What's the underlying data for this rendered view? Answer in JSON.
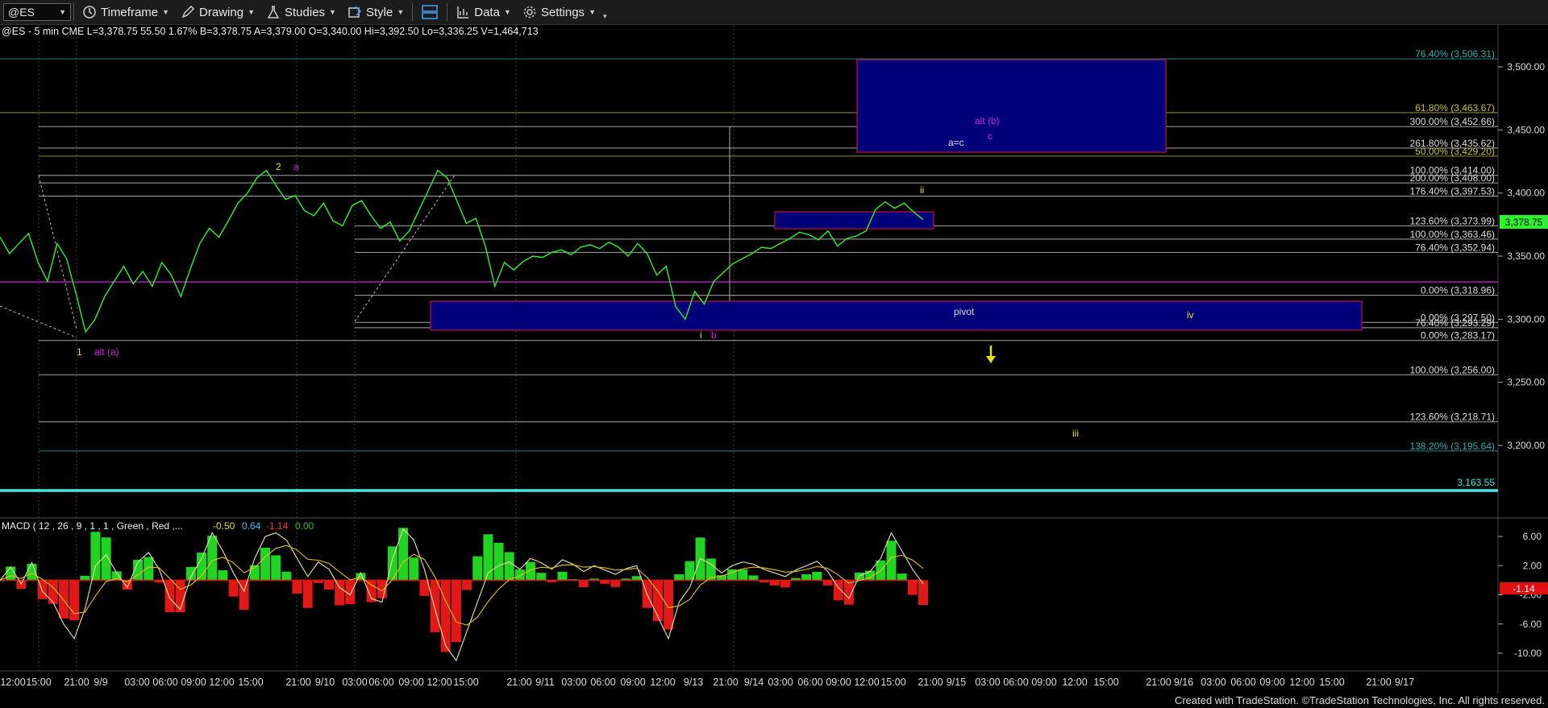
{
  "toolbar": {
    "symbol": "@ES",
    "items": [
      {
        "icon": "clock-icon",
        "label": "Timeframe"
      },
      {
        "icon": "pencil-icon",
        "label": "Drawing"
      },
      {
        "icon": "flask-icon",
        "label": "Studies"
      },
      {
        "icon": "style-icon",
        "label": "Style"
      },
      {
        "icon": "layout-icon",
        "label": ""
      },
      {
        "icon": "bar-chart-icon",
        "label": "Data"
      },
      {
        "icon": "gear-icon",
        "label": "Settings"
      }
    ]
  },
  "header_text": "@ES - 5 min  CME  L=3,378.75  55.50  1.67%  B=3,378.75  A=3,379.00  O=3,340.00  Hi=3,392.50  Lo=3,336.25  V=1,464,713",
  "macd_header": {
    "label": "MACD ( 12 , 26 , 9 , 1 , 1 , Green , Red ,...",
    "v1": "-0.50",
    "v2": "0.64",
    "v3": "-1.14",
    "v4": "0.00"
  },
  "footer": "Created with TradeStation. ©TradeStation Technologies, Inc. All rights reserved.",
  "colors": {
    "price": "#2ef22e",
    "magenta": "#d020e0",
    "yellow": "#e6e020",
    "cyan": "#40e0e0",
    "box": "#00007a",
    "boxBorder": "#c01040"
  },
  "chart_data": [
    {
      "type": "line",
      "title": "@ES - 5 min",
      "ylim": [
        3140,
        3520
      ],
      "y_ticks": [
        "3,500.00",
        "3,450.00",
        "3,400.00",
        "3,350.00",
        "3,300.00",
        "3,250.00",
        "3,200.00"
      ],
      "last_price": "3,378.75",
      "x_ticks": [
        "12:00",
        "15:00",
        "21:00",
        "9/9",
        "03:00",
        "06:00",
        "09:00",
        "12:00",
        "15:00",
        "21:00",
        "9/10",
        "03:00",
        "06:00",
        "09:00",
        "12:00",
        "15:00",
        "21:00",
        "9/11",
        "03:00",
        "06:00",
        "09:00",
        "12:00",
        "9/13",
        "21:00",
        "9/14",
        "03:00",
        "06:00",
        "09:00",
        "12:00",
        "15:00",
        "21:00",
        "9/15",
        "03:00",
        "06:00",
        "09:00",
        "12:00",
        "15:00",
        "21:00",
        "9/16",
        "03:00",
        "06:00",
        "09:00",
        "12:00",
        "15:00",
        "21:00",
        "9/17"
      ],
      "series": [
        {
          "values": [
            3365,
            3352,
            3360,
            3368,
            3345,
            3330,
            3360,
            3348,
            3320,
            3290,
            3300,
            3318,
            3330,
            3342,
            3328,
            3338,
            3326,
            3345,
            3335,
            3318,
            3340,
            3360,
            3372,
            3365,
            3378,
            3392,
            3400,
            3412,
            3418,
            3406,
            3395,
            3398,
            3386,
            3382,
            3392,
            3378,
            3374,
            3390,
            3394,
            3382,
            3372,
            3377,
            3362,
            3370,
            3386,
            3402,
            3418,
            3412,
            3394,
            3376,
            3380,
            3358,
            3326,
            3345,
            3339,
            3346,
            3350,
            3349,
            3353,
            3355,
            3351,
            3357,
            3359,
            3356,
            3361,
            3357,
            3350,
            3360,
            3352,
            3335,
            3342,
            3310,
            3300,
            3322,
            3312,
            3330,
            3337,
            3344,
            3348,
            3352,
            3357,
            3356,
            3360,
            3364,
            3369,
            3367,
            3363,
            3370,
            3358,
            3364,
            3366,
            3370,
            3387,
            3393,
            3388,
            3392,
            3385,
            3379
          ]
        }
      ],
      "fib_levels": [
        {
          "label": "76.40% (3,506.31)",
          "value": 3506.31,
          "color": "#2ab0b0"
        },
        {
          "label": "61.80% (3,463.67)",
          "value": 3463.67,
          "color": "#c8c030"
        },
        {
          "label": "300.00% (3,452.66)",
          "value": 3452.66,
          "color": "#dddddd"
        },
        {
          "label": "261.80% (3,435.62)",
          "value": 3435.62,
          "color": "#dddddd"
        },
        {
          "label": "50.00% (3,429.20)",
          "value": 3429.2,
          "color": "#c8c030"
        },
        {
          "label": "100.00% (3,414.00)",
          "value": 3414.0,
          "color": "#dddddd"
        },
        {
          "label": "200.00% (3,408.00)",
          "value": 3408.0,
          "color": "#dddddd"
        },
        {
          "label": "176.40% (3,397.53)",
          "value": 3397.53,
          "color": "#dddddd"
        },
        {
          "label": "123.60% (3,373.99)",
          "value": 3373.99,
          "color": "#dddddd"
        },
        {
          "label": "100.00% (3,363.46)",
          "value": 3363.46,
          "color": "#dddddd"
        },
        {
          "label": "76.40% (3,352.94)",
          "value": 3352.94,
          "color": "#dddddd"
        },
        {
          "label": "0.00% (3,318.96)",
          "value": 3318.96,
          "color": "#dddddd"
        },
        {
          "label": "0.00% (3,297.50)",
          "value": 3297.5,
          "color": "#dddddd"
        },
        {
          "label": "76.40% (3,293.29)",
          "value": 3293.29,
          "color": "#dddddd"
        },
        {
          "label": "0.00% (3,283.17)",
          "value": 3283.17,
          "color": "#dddddd"
        },
        {
          "label": "100.00% (3,256.00)",
          "value": 3256.0,
          "color": "#dddddd"
        },
        {
          "label": "123.60% (3,218.71)",
          "value": 3218.71,
          "color": "#dddddd"
        },
        {
          "label": "138.20% (3,195.64)",
          "value": 3195.64,
          "color": "#2ab0b0"
        }
      ],
      "support_line": {
        "label": "3,163.55",
        "value": 3163.55
      },
      "annotations": [
        {
          "text": "1",
          "color": "#e6e020"
        },
        {
          "text": "alt (a)",
          "color": "#d020e0"
        },
        {
          "text": "2",
          "color": "#e6e020"
        },
        {
          "text": "a",
          "color": "#d020e0"
        },
        {
          "text": "i",
          "color": "#e6e020"
        },
        {
          "text": "b",
          "color": "#d020e0"
        },
        {
          "text": "ii",
          "color": "#e6e020"
        },
        {
          "text": "alt (b)",
          "color": "#d020e0"
        },
        {
          "text": "c",
          "color": "#d020e0"
        },
        {
          "text": "a=c",
          "color": "#dddddd"
        },
        {
          "text": "pivot",
          "color": "#dddddd"
        },
        {
          "text": "iv",
          "color": "#e6e020"
        },
        {
          "text": "iii",
          "color": "#e6e020"
        }
      ]
    },
    {
      "type": "line",
      "title": "MACD ( 12 , 26 , 9 , 1 , 1 , Green , Red ,...",
      "ylim": [
        -11,
        7
      ],
      "y_ticks": [
        "6.00",
        "2.00",
        "-2.00",
        "-6.00",
        "-10.00"
      ],
      "last_value": "-1.14",
      "series": [
        {
          "values": [
            0,
            1.8,
            -0.5,
            2.4,
            -1.5,
            -3,
            -6,
            -8,
            -4,
            2,
            3.5,
            1,
            -1,
            2.5,
            3.8,
            1.5,
            -2.5,
            -4,
            0.5,
            3,
            6.5,
            4,
            1,
            -1.5,
            3,
            6,
            6.5,
            5.5,
            3,
            0.5,
            2.5,
            1.5,
            -1,
            -2,
            1,
            -2.5,
            -3,
            3,
            7,
            5.5,
            1.5,
            -4,
            -9,
            -11,
            -7,
            -3,
            1,
            2,
            2.5,
            1.5,
            3,
            2.4,
            1.5,
            2.8,
            2.2,
            1.2,
            2,
            1.4,
            0.8,
            1.6,
            2,
            -2,
            -5,
            -8,
            -3,
            -1,
            3,
            2.2,
            1,
            2,
            2.5,
            2.2,
            1.5,
            1,
            0.5,
            1.4,
            2,
            2.6,
            1.2,
            -1,
            -2.5,
            0.6,
            1.2,
            3,
            6.5,
            4,
            1.5,
            -0.5
          ]
        }
      ]
    }
  ]
}
